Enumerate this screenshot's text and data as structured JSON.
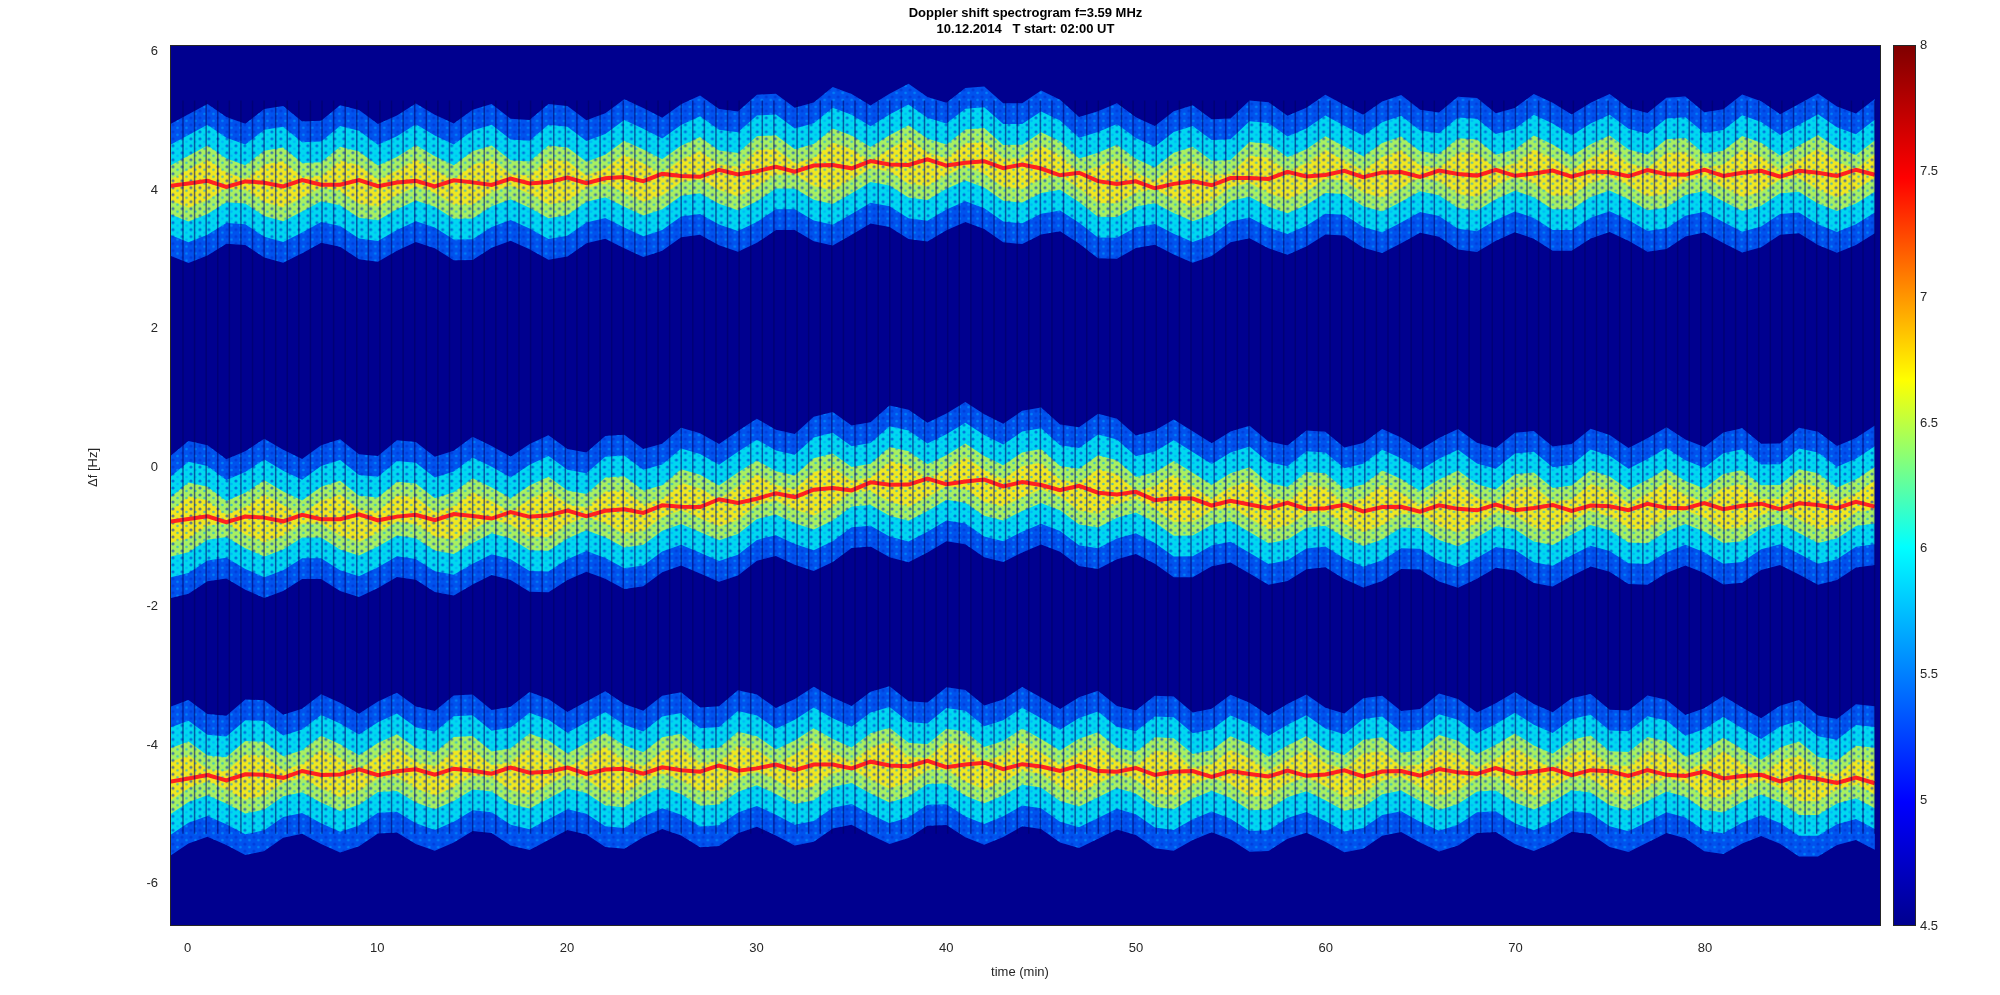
{
  "figure": {
    "title": "Doppler shift spectrogram f=3.59 MHz",
    "subtitle": "10.12.2014   T start: 02:00 UT",
    "ylabel": "Δf [Hz]",
    "xlabel": "time (min)",
    "yticks": [
      "6",
      "4",
      "2",
      "0",
      "-2",
      "-4",
      "-6"
    ],
    "xticks": [
      "0",
      "10",
      "20",
      "30",
      "40",
      "50",
      "60",
      "70",
      "80"
    ],
    "colorbar": {
      "ticks": [
        "8",
        "7.5",
        "7",
        "6.5",
        "6",
        "5.5",
        "5",
        "4.5"
      ]
    }
  }
}
